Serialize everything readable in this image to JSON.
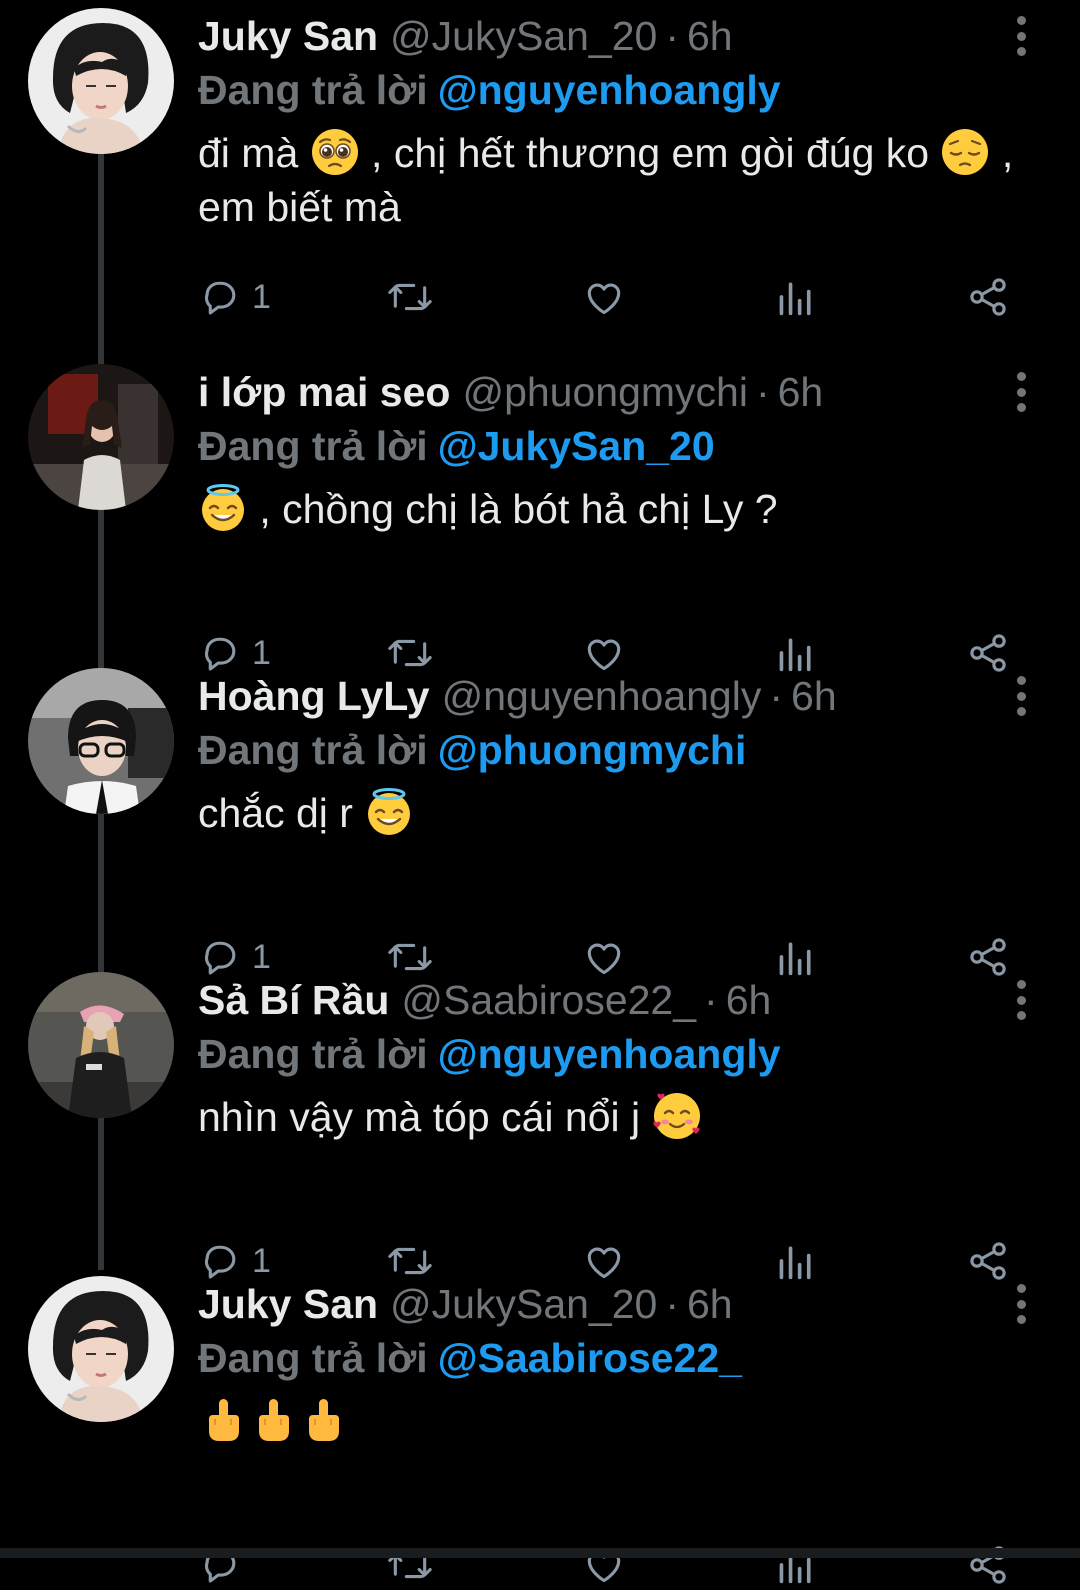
{
  "colors": {
    "background": "#000000",
    "text_primary": "#e7e9ea",
    "text_secondary": "#71767b",
    "accent": "#1d9bf0",
    "thread_line": "#333639"
  },
  "tweets": [
    {
      "display_name": "Juky San",
      "handle": "@JukySan_20",
      "separator": "·",
      "time": "6h",
      "reply_prefix": "Đang trả lời",
      "reply_target": "@nguyenhoangly",
      "text_parts": [
        "đi mà ",
        " , chị hết thương em gòi đúg ko ",
        " , em biết mà"
      ],
      "emojis": [
        "pleading-face-emoji",
        "pensive-face-emoji"
      ],
      "reply_count": "1"
    },
    {
      "display_name": "i lớp mai seo",
      "handle": "@phuongmychi",
      "separator": "·",
      "time": "6h",
      "reply_prefix": "Đang trả lời",
      "reply_target": "@JukySan_20",
      "text_parts": [
        "",
        " , chồng chị là bót hả chị Ly ?"
      ],
      "emojis": [
        "smiling-face-with-halo-emoji"
      ],
      "reply_count": "1"
    },
    {
      "display_name": "Hoàng LyLy",
      "handle": "@nguyenhoangly",
      "separator": "·",
      "time": "6h",
      "reply_prefix": "Đang trả lời",
      "reply_target": "@phuongmychi",
      "text_parts": [
        "chắc dị r ",
        ""
      ],
      "emojis": [
        "smiling-face-with-halo-emoji"
      ],
      "reply_count": "1"
    },
    {
      "display_name": "Sả Bí Rầu",
      "handle": "@Saabirose22_",
      "separator": "·",
      "time": "6h",
      "reply_prefix": "Đang trả lời",
      "reply_target": "@nguyenhoangly",
      "text_parts": [
        "nhìn vậy mà tóp cái nổi j ",
        ""
      ],
      "emojis": [
        "smiling-face-with-hearts-emoji"
      ],
      "reply_count": "1"
    },
    {
      "display_name": "Juky San",
      "handle": "@JukySan_20",
      "separator": "·",
      "time": "6h",
      "reply_prefix": "Đang trả lời",
      "reply_target": "@Saabirose22_",
      "text_parts": [
        "",
        "",
        "",
        ""
      ],
      "emojis": [
        "middle-finger-emoji",
        "middle-finger-emoji",
        "middle-finger-emoji"
      ],
      "reply_count": ""
    }
  ],
  "icons": {
    "reply": "reply-icon",
    "retweet": "retweet-icon",
    "like": "heart-icon",
    "views": "views-icon",
    "share": "share-icon",
    "more": "more-vertical-icon"
  }
}
